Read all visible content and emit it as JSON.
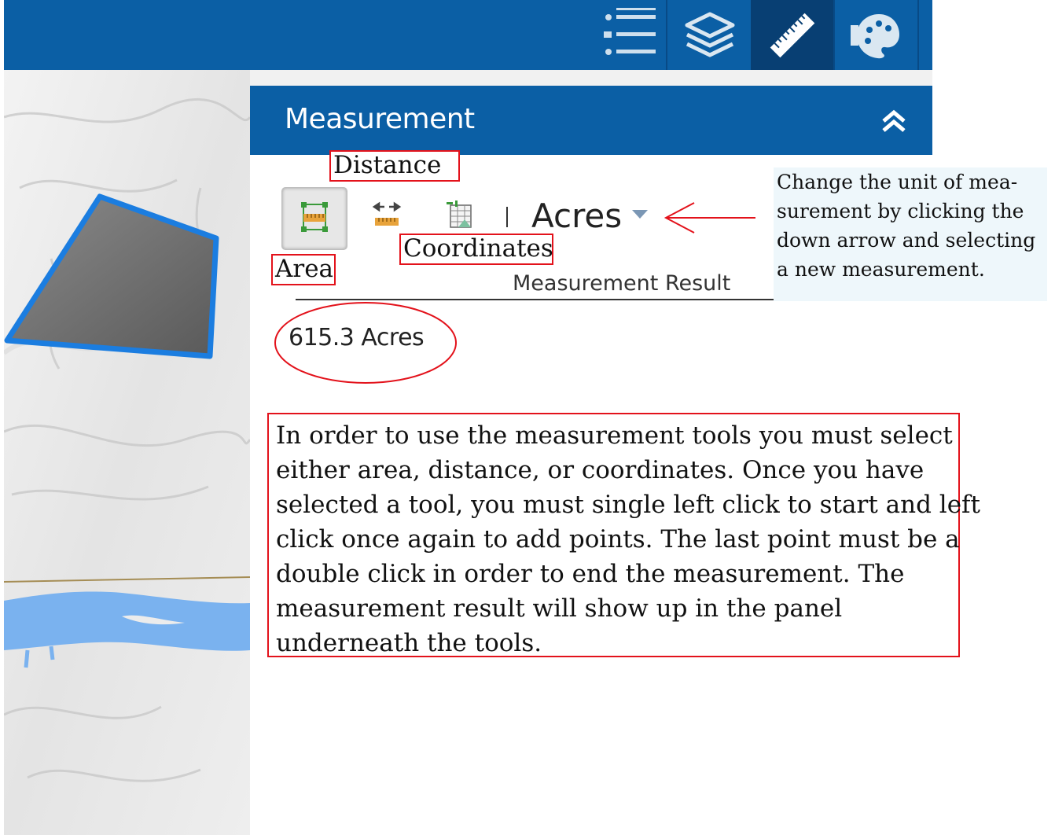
{
  "toolbar": {
    "buttons": [
      {
        "name": "legend",
        "icon": "legend-list-icon",
        "active": false
      },
      {
        "name": "layers",
        "icon": "layers-icon",
        "active": false
      },
      {
        "name": "measurement",
        "icon": "ruler-icon",
        "active": true
      },
      {
        "name": "basemap",
        "icon": "palette-icon",
        "active": false
      }
    ],
    "bg_color": "#0b5fa5",
    "active_color": "#083f73"
  },
  "panel": {
    "title": "Measurement",
    "collapse_icon": "double-chevron-up-icon",
    "tools": [
      {
        "icon": "area-ruler-icon",
        "selected": true
      },
      {
        "icon": "distance-ruler-icon",
        "selected": false
      },
      {
        "icon": "coordinates-icon",
        "selected": false
      }
    ],
    "unit": {
      "value": "Acres",
      "icon": "dropdown-arrow-icon"
    },
    "result_header": "Measurement Result",
    "result_value": "615.3 Acres"
  },
  "annotations": {
    "distance": "Distance",
    "coordinates": "Coordinates",
    "area": "Area",
    "callout_lines": [
      "Change the unit of mea-",
      "surement by clicking the",
      "down arrow and selecting",
      "a new measurement."
    ],
    "instruction_lines": [
      "In order to use the measurement tools you must select",
      "either area, distance, or coordinates. Once you have",
      "selected a tool, you must single left click to start and left",
      "click once again to add points. The last point must be a",
      "double click in order to end the measurement. The",
      "measurement result will show up in the panel",
      "underneath the tools."
    ],
    "highlight_color": "#e3121b"
  },
  "map": {
    "polygon_fill": "#6e6e6e",
    "polygon_outline": "#1b7de0",
    "river_color": "#7ab2ef"
  }
}
